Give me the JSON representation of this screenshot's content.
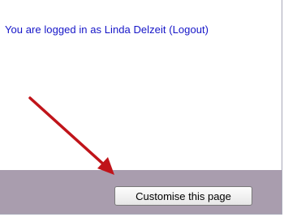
{
  "login": {
    "prefix": "You are logged in as",
    "user_name": "Linda Delzeit",
    "logout_label": "(Logout)"
  },
  "footer": {
    "customise_label": "Customise this page"
  },
  "colors": {
    "link": "#1515c8",
    "footer_bar": "#a99dae",
    "arrow": "#c0141a"
  },
  "annotation": {
    "arrow_icon": "arrow-pointer-icon"
  }
}
